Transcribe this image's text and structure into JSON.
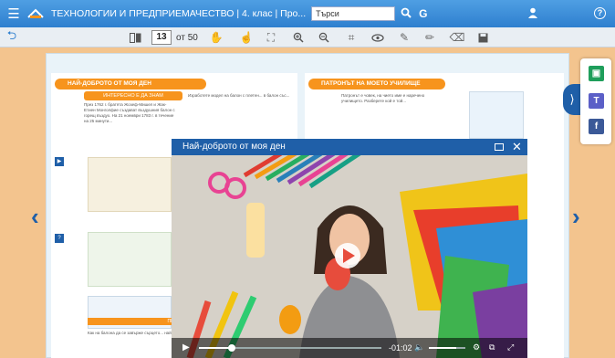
{
  "topbar": {
    "title": "ТЕХНОЛОГИИ И ПРЕДПРИЕМАЧЕСТВО | 4. клас | Про...",
    "search_placeholder": "Търси",
    "search_icon": "search-icon",
    "g_label": "G"
  },
  "toolbar": {
    "page": "13",
    "of_label": "от 50"
  },
  "book": {
    "left_header": "НАЙ-ДОБРОТО ОТ МОЯ ДЕН",
    "right_header": "ПАТРОНЪТ НА МОЕТО УЧИЛИЩЕ",
    "interesting": "ИНТЕРЕСНО Е ДА ЗНАМ",
    "present": "ПРЕДАГАМ ИДЕ",
    "left_col": "През 1762 г. братята Жозеф-Мишел и Жак-Етиен Монголфие създават въздушния балон с горещ въздух. На 21 ноември 1783 г. в течение на 25 минути...",
    "mid_col": "Изработете модел на балон с плетен... в балон със...",
    "right_col": "Патронът е човек, на чието име е наречено училището. Разберете кой е той...",
    "bottom_text": "Как на балона да се завърже сърцето... най-доброто..."
  },
  "video": {
    "title": "Най-доброто от моя ден",
    "time": "-01:02",
    "progress": 0.18,
    "volume": 0.75
  },
  "colors": {
    "accent": "#1f5fa8",
    "orange": "#f7941d",
    "topbar": "#2e7fcf"
  }
}
